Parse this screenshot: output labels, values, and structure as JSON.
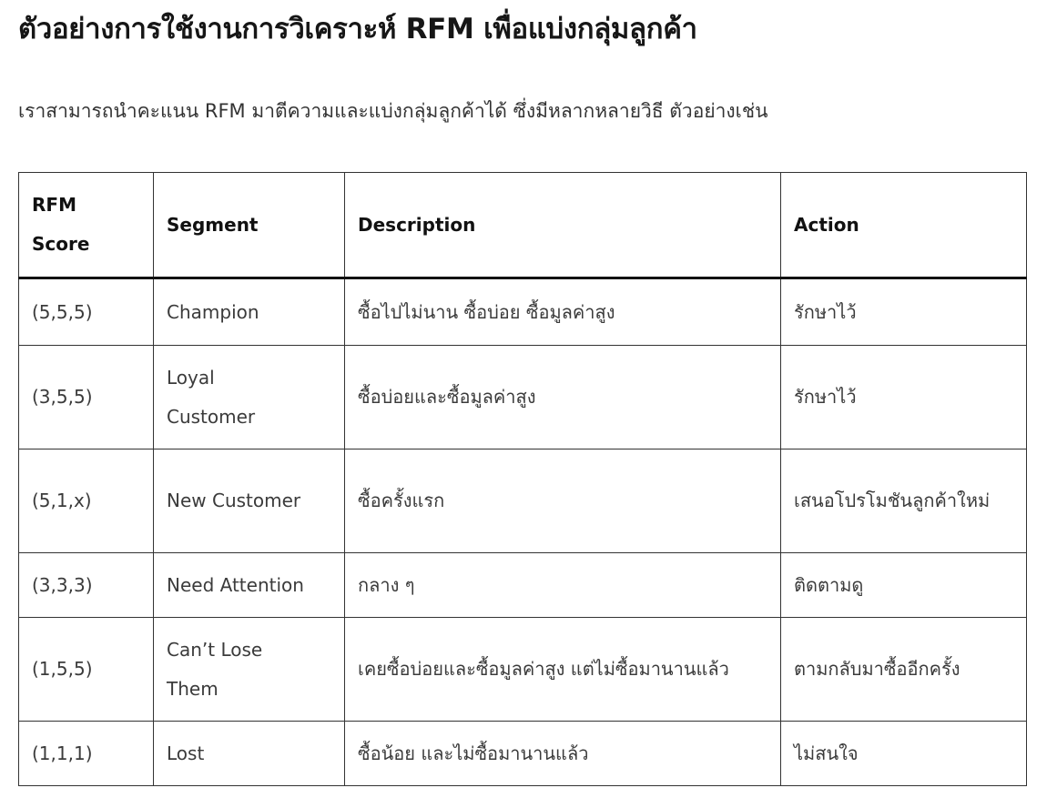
{
  "page": {
    "title": "ตัวอย่างการใช้งานการวิเคราะห์ RFM เพื่อแบ่งกลุ่มลูกค้า",
    "intro": "เราสามารถนำคะแนน RFM มาตีความและแบ่งกลุ่มลูกค้าได้ ซึ่งมีหลากหลายวิธี ตัวอย่างเช่น"
  },
  "table": {
    "headers": [
      "RFM Score",
      "Segment",
      "Description",
      "Action"
    ],
    "rows": [
      {
        "score": "(5,5,5)",
        "segment": "Champion",
        "description": "ซื้อไปไม่นาน ซื้อบ่อย ซื้อมูลค่าสูง",
        "action": "รักษาไว้"
      },
      {
        "score": "(3,5,5)",
        "segment": "Loyal Customer",
        "description": "ซื้อบ่อยและซื้อมูลค่าสูง",
        "action": "รักษาไว้"
      },
      {
        "score": "(5,1,x)",
        "segment": "New Customer",
        "description": "ซื้อครั้งแรก",
        "action": "เสนอโปรโมชันลูกค้าใหม่"
      },
      {
        "score": "(3,3,3)",
        "segment": "Need Attention",
        "description": "กลาง ๆ",
        "action": "ติดตามดู"
      },
      {
        "score": "(1,5,5)",
        "segment": "Can’t Lose Them",
        "description": "เคยซื้อบ่อยและซื้อมูลค่าสูง แต่ไม่ซื้อมานานแล้ว",
        "action": "ตามกลับมาซื้ออีกครั้ง"
      },
      {
        "score": "(1,1,1)",
        "segment": "Lost",
        "description": "ซื้อน้อย และไม่ซื้อมานานแล้ว",
        "action": "ไม่สนใจ"
      }
    ]
  }
}
